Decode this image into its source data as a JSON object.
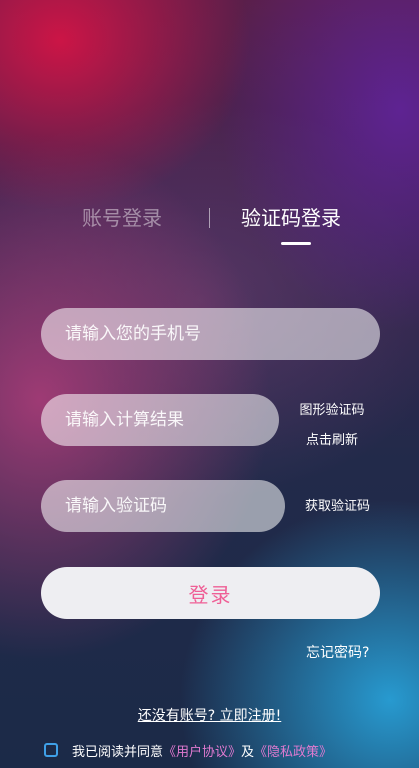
{
  "tabs": {
    "account_login": "账号登录",
    "separator": "|",
    "sms_login": "验证码登录",
    "active": "sms_login"
  },
  "form": {
    "phone_placeholder": "请输入您的手机号",
    "calc_placeholder": "请输入计算结果",
    "code_placeholder": "请输入验证码",
    "captcha_line1": "图形验证码",
    "captcha_line2": "点击刷新",
    "get_code": "获取验证码",
    "login": "登录",
    "forgot": "忘记密码?"
  },
  "footer": {
    "register": "还没有账号? 立即注册!",
    "agree_prefix": "我已阅读并同意",
    "user_agreement": "《用户协议》",
    "and": "及",
    "privacy_policy": "《隐私政策》"
  },
  "colors": {
    "login_text": "#ef5f96",
    "link": "#e07ad0",
    "checkbox_border": "#3fa0e8"
  },
  "icons": {
    "checkbox": "checkbox-icon"
  }
}
